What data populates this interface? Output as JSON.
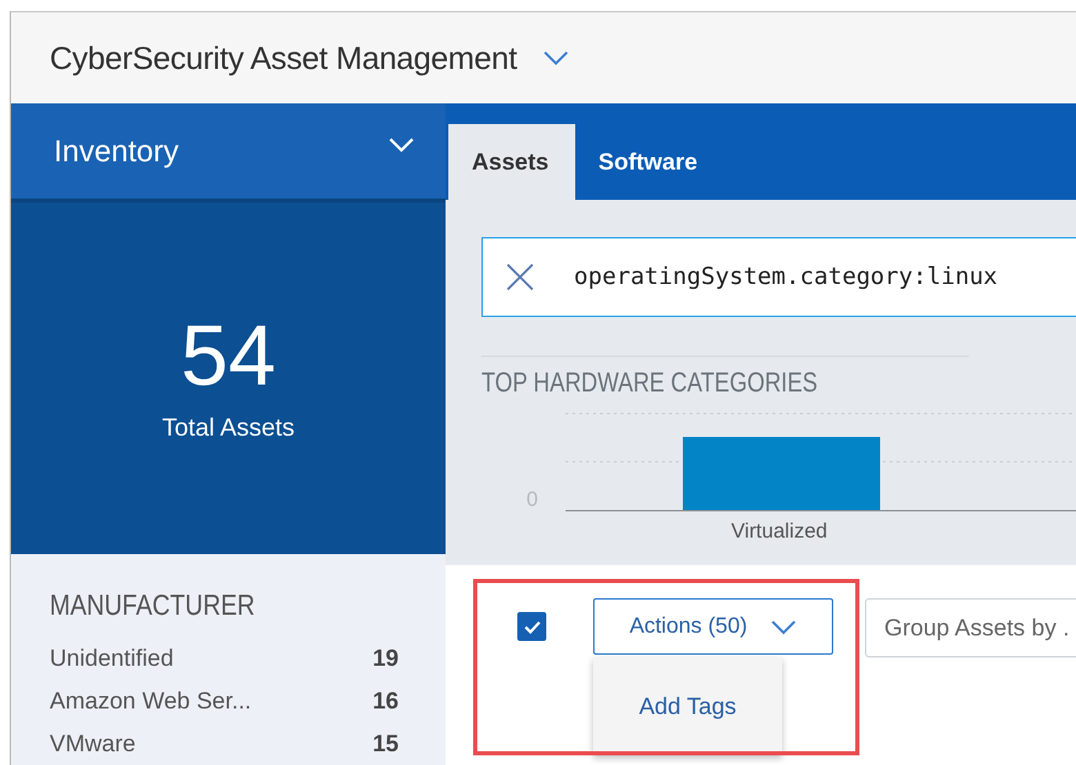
{
  "app": {
    "title": "CyberSecurity Asset Management"
  },
  "sidebar": {
    "title": "Inventory",
    "total": {
      "value": "54",
      "label": "Total Assets"
    },
    "manufacturer": {
      "title": "MANUFACTURER",
      "items": [
        {
          "name": "Unidentified",
          "count": "19"
        },
        {
          "name": "Amazon Web Ser...",
          "count": "16"
        },
        {
          "name": "VMware",
          "count": "15"
        }
      ]
    }
  },
  "tabs": [
    {
      "label": "Assets",
      "selected": true
    },
    {
      "label": "Software",
      "selected": false
    }
  ],
  "search": {
    "value": "operatingSystem.category:linux"
  },
  "chart": {
    "title": "TOP HARDWARE CATEGORIES",
    "axis_label": "0",
    "category": "Virtualized"
  },
  "toolbar": {
    "highlighted": true,
    "select_all_checked": true,
    "actions_button": "Actions (50)",
    "group_by": {
      "placeholder": "Group Assets by ."
    },
    "menu": [
      "Add Tags"
    ]
  }
}
